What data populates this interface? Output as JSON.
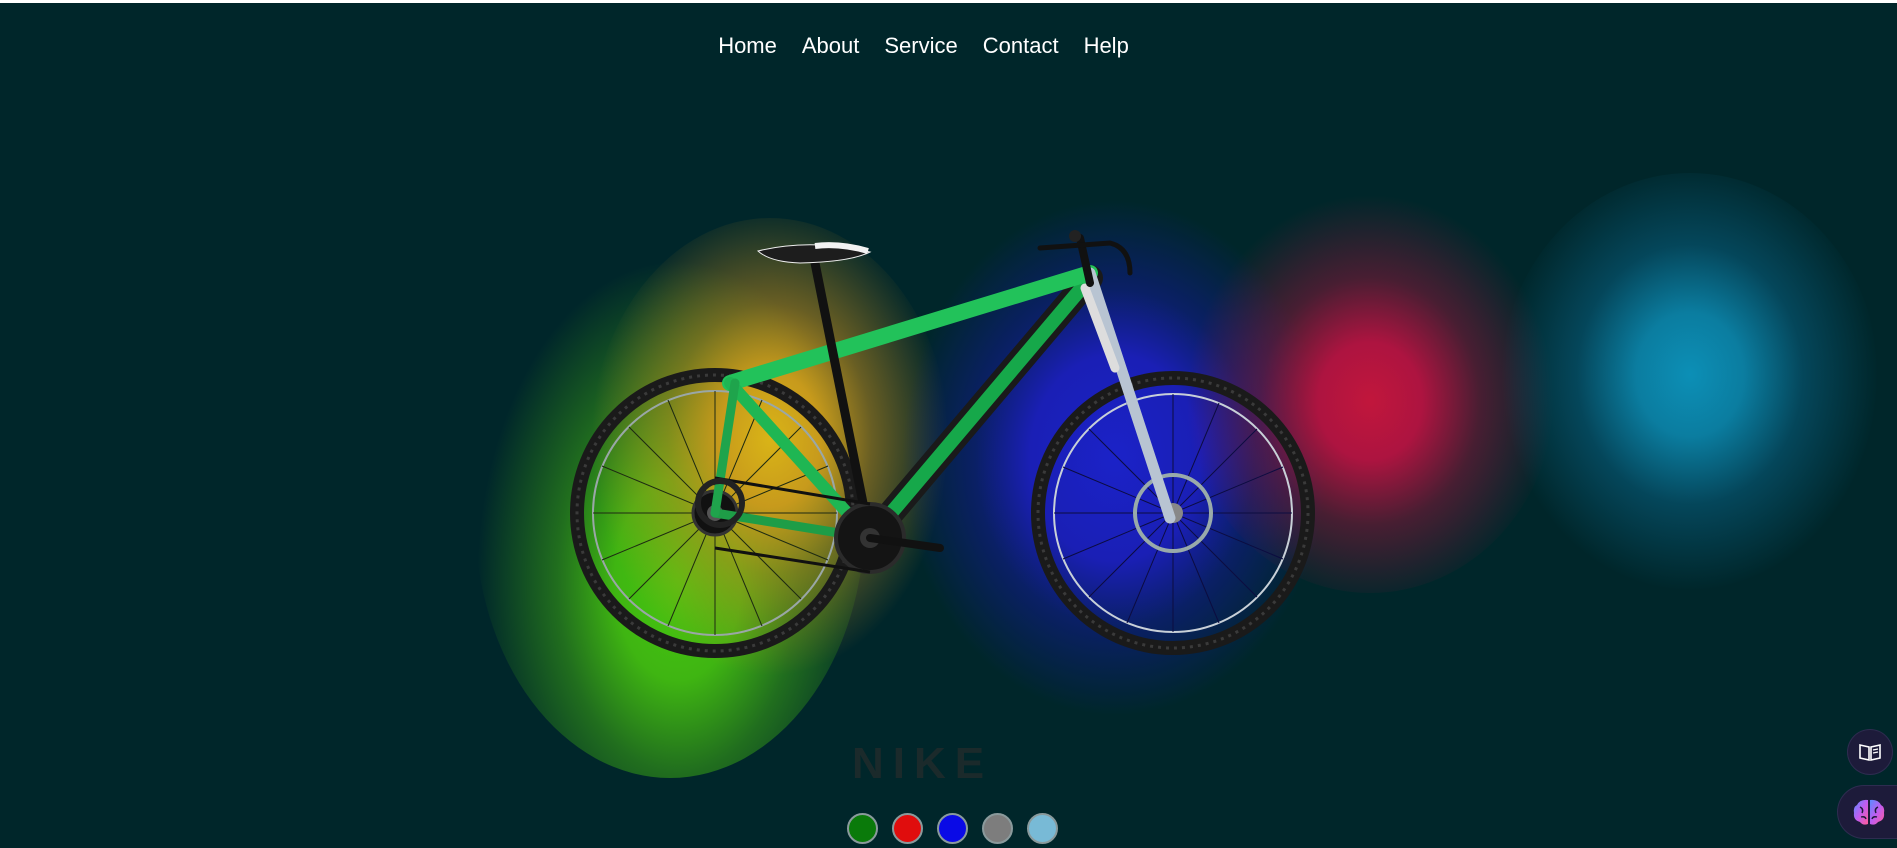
{
  "nav": {
    "items": [
      "Home",
      "About",
      "Service",
      "Contact",
      "Help"
    ]
  },
  "hero": {
    "brand": "NIKE",
    "product_image": "green mountain bike",
    "glow_colors": [
      "#46c80f",
      "#d9b417",
      "#1b22c8",
      "#c1163c",
      "#0c8fb6"
    ]
  },
  "swatches": [
    {
      "color": "#0a7a0a",
      "name": "green"
    },
    {
      "color": "#e00d0d",
      "name": "red"
    },
    {
      "color": "#0a0ae6",
      "name": "blue"
    },
    {
      "color": "#7d7d7d",
      "name": "gray"
    },
    {
      "color": "#78bad6",
      "name": "light-blue"
    }
  ],
  "floating_buttons": [
    {
      "icon": "book-icon"
    },
    {
      "icon": "brain-icon"
    }
  ],
  "colors": {
    "background": "#00262a",
    "nav_text": "#ffffff",
    "brand_text": "#1b2a2b"
  }
}
